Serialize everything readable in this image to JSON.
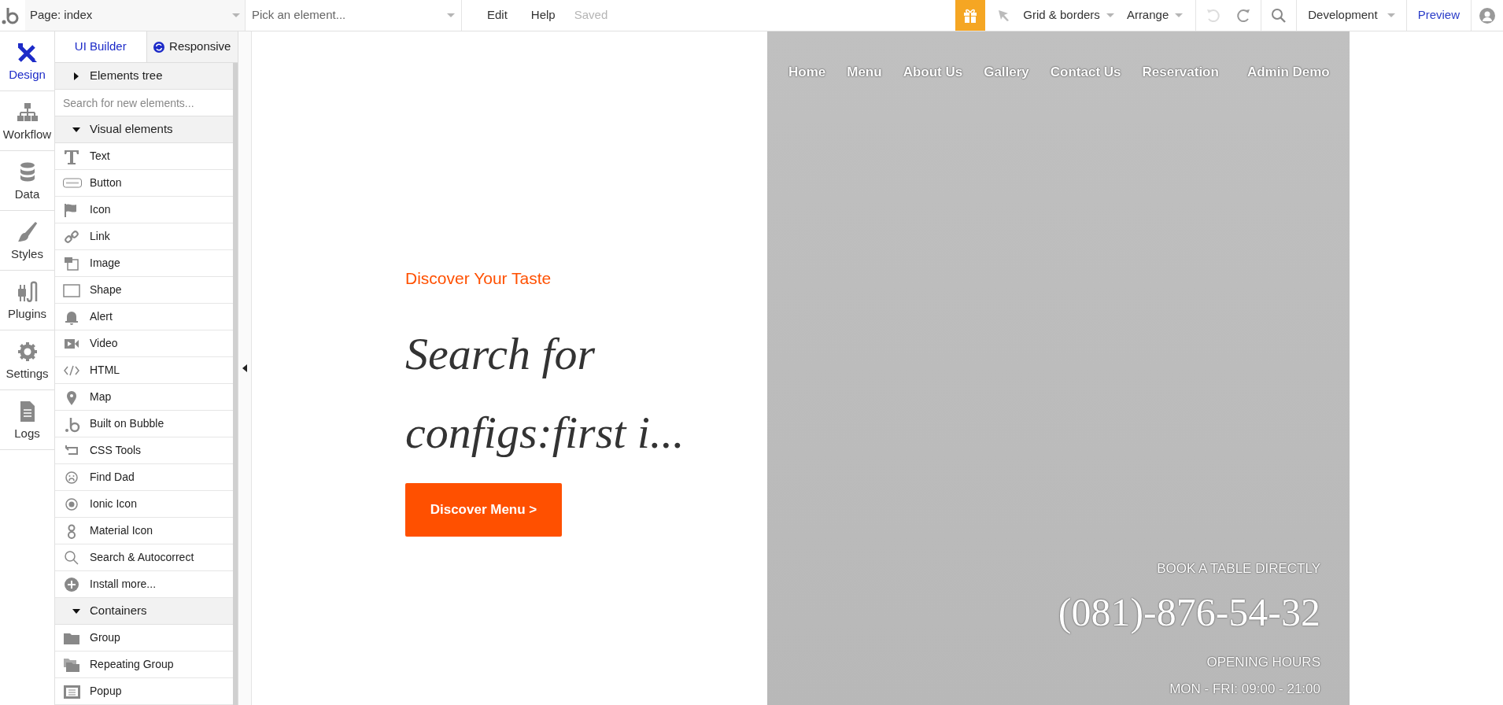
{
  "topbar": {
    "page_selector": "Page: index",
    "element_picker": {
      "placeholder": "Pick an element..."
    },
    "menu": [
      "Edit",
      "Help"
    ],
    "save_status": "Saved",
    "toolbar_menus": [
      "Grid & borders",
      "Arrange"
    ],
    "environment": "Development",
    "preview": "Preview"
  },
  "nav": [
    {
      "label": "Design",
      "selected": true
    },
    {
      "label": "Workflow",
      "selected": false
    },
    {
      "label": "Data",
      "selected": false
    },
    {
      "label": "Styles",
      "selected": false
    },
    {
      "label": "Plugins",
      "selected": false
    },
    {
      "label": "Settings",
      "selected": false
    },
    {
      "label": "Logs",
      "selected": false
    }
  ],
  "panel": {
    "tabs": [
      {
        "label": "UI Builder",
        "selected": true
      },
      {
        "label": "Responsive",
        "selected": false
      }
    ],
    "rows": [
      {
        "kind": "section",
        "title": "Elements tree",
        "expanded": false
      },
      {
        "kind": "search",
        "placeholder": "Search for new elements..."
      },
      {
        "kind": "section",
        "title": "Visual elements",
        "expanded": true
      },
      {
        "kind": "item",
        "label": "Text"
      },
      {
        "kind": "item",
        "label": "Button"
      },
      {
        "kind": "item",
        "label": "Icon"
      },
      {
        "kind": "item",
        "label": "Link"
      },
      {
        "kind": "item",
        "label": "Image"
      },
      {
        "kind": "item",
        "label": "Shape"
      },
      {
        "kind": "item",
        "label": "Alert"
      },
      {
        "kind": "item",
        "label": "Video"
      },
      {
        "kind": "item",
        "label": "HTML"
      },
      {
        "kind": "item",
        "label": "Map"
      },
      {
        "kind": "item",
        "label": "Built on Bubble"
      },
      {
        "kind": "item",
        "label": "CSS Tools"
      },
      {
        "kind": "item",
        "label": "Find Dad"
      },
      {
        "kind": "item",
        "label": "Ionic Icon"
      },
      {
        "kind": "item",
        "label": "Material Icon"
      },
      {
        "kind": "item",
        "label": "Search & Autocorrect"
      },
      {
        "kind": "item",
        "label": "Install more..."
      },
      {
        "kind": "section",
        "title": "Containers",
        "expanded": true
      },
      {
        "kind": "item",
        "label": "Group"
      },
      {
        "kind": "item",
        "label": "Repeating Group"
      },
      {
        "kind": "item",
        "label": "Popup"
      }
    ]
  },
  "canvas": {
    "hero": {
      "eyebrow": "Discover Your Taste",
      "heading": "Search for configs:first i...",
      "button": "Discover Menu >"
    },
    "site_nav": [
      "Home",
      "Menu",
      "About Us",
      "Gallery",
      "Contact Us",
      "Reservation",
      "Admin Demo"
    ],
    "booking": {
      "label": "BOOK A TABLE DIRECTLY",
      "phone": "(081)-876-54-32",
      "hours_label": "OPENING HOURS",
      "hours": "MON - FRI: 09:00 - 21:00"
    }
  }
}
